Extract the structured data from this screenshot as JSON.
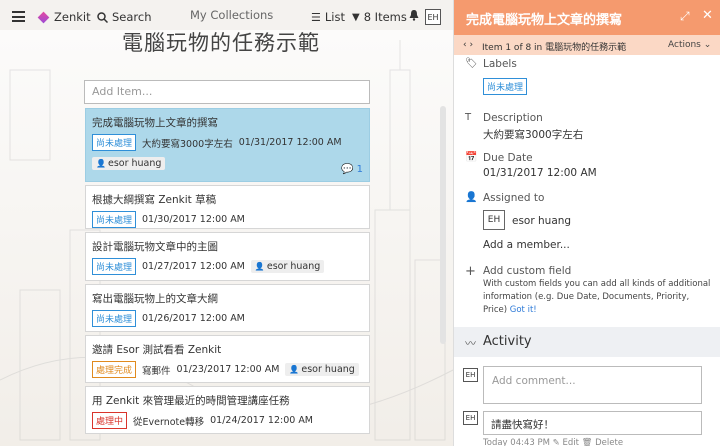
{
  "topbar": {
    "app_name": "Zenkit",
    "search_label": "Search",
    "collections_label": "My Collections",
    "list_label": "List",
    "items_label": "8 Items",
    "avatar_initials": "EH"
  },
  "board": {
    "title": "電腦玩物的任務示範",
    "add_placeholder": "Add Item..."
  },
  "cards": [
    {
      "title": "完成電腦玩物上文章的撰寫",
      "badge": "尚未處理",
      "badge_color": "#2f8fd8",
      "note": "大約要寫3000字左右",
      "date": "01/31/2017 12:00 AM",
      "person": "esor huang",
      "comments": "1"
    },
    {
      "title": "根據大綱撰寫 Zenkit 草稿",
      "badge": "尚未處理",
      "badge_color": "#2f8fd8",
      "date": "01/30/2017 12:00 AM"
    },
    {
      "title": "設計電腦玩物文章中的主圖",
      "badge": "尚未處理",
      "badge_color": "#2f8fd8",
      "date": "01/27/2017 12:00 AM",
      "person": "esor huang"
    },
    {
      "title": "寫出電腦玩物上的文章大綱",
      "badge": "尚未處理",
      "badge_color": "#2f8fd8",
      "date": "01/26/2017 12:00 AM"
    },
    {
      "title": "邀請 Esor 測試看看 Zenkit",
      "badge": "處理完成",
      "badge_color": "#e08a1e",
      "note": "寫郵件",
      "date": "01/23/2017 12:00 AM",
      "person": "esor huang"
    },
    {
      "title": "用 Zenkit 來管理最近的時間管理講座任務",
      "badge": "處理中",
      "badge_color": "#d9342b",
      "note": "從Evernote轉移",
      "date": "01/24/2017 12:00 AM"
    }
  ],
  "detail": {
    "title": "完成電腦玩物上文章的撰寫",
    "position": "Item 1 of 8 in 電腦玩物的任務示範",
    "actions_label": "Actions",
    "labels_label": "Labels",
    "label_value": "尚未處理",
    "description_label": "Description",
    "description_value": "大約要寫3000字左右",
    "due_label": "Due Date",
    "due_value": "01/31/2017 12:00 AM",
    "assigned_label": "Assigned to",
    "assignee_initials": "EH",
    "assignee_name": "esor huang",
    "add_member": "Add a member...",
    "custom_field_label": "Add custom field",
    "custom_field_desc": "With custom fields you can add all kinds of additional information (e.g. Due Date, Documents, Priority, Price)",
    "got_it": "Got it!",
    "activity_label": "Activity",
    "comment_placeholder": "Add comment...",
    "comment_text": "請盡快寫好！",
    "comment_meta": "Today 04:43 PM   ✎ Edit   🗑 Delete",
    "header_color": "#f59a6e"
  }
}
